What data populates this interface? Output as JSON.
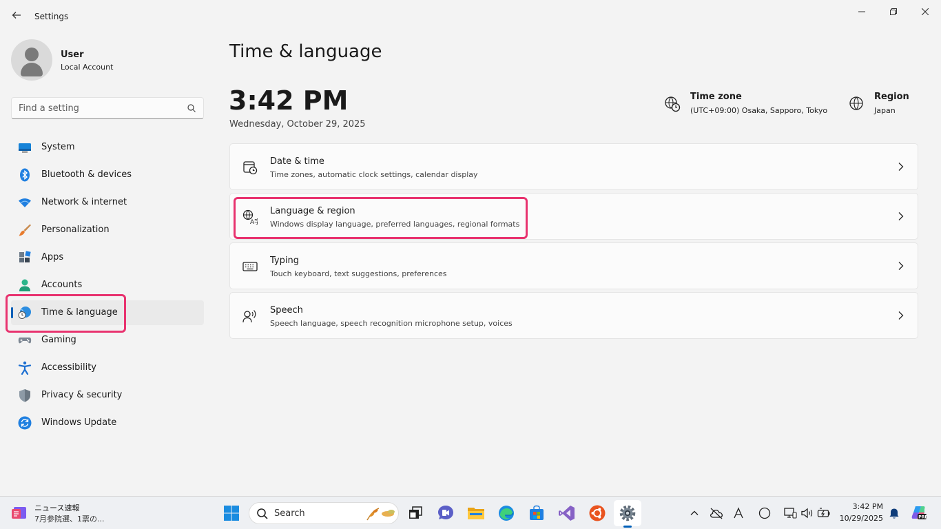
{
  "window": {
    "app_title": "Settings"
  },
  "profile": {
    "name": "User",
    "account_type": "Local Account"
  },
  "search": {
    "placeholder": "Find a setting"
  },
  "sidebar": {
    "items": [
      {
        "label": "System",
        "icon": "monitor-icon"
      },
      {
        "label": "Bluetooth & devices",
        "icon": "bluetooth-icon"
      },
      {
        "label": "Network & internet",
        "icon": "wifi-icon"
      },
      {
        "label": "Personalization",
        "icon": "paintbrush-icon"
      },
      {
        "label": "Apps",
        "icon": "apps-icon"
      },
      {
        "label": "Accounts",
        "icon": "person-icon"
      },
      {
        "label": "Time & language",
        "icon": "globe-clock-icon",
        "selected": true
      },
      {
        "label": "Gaming",
        "icon": "gamepad-icon"
      },
      {
        "label": "Accessibility",
        "icon": "accessibility-icon"
      },
      {
        "label": "Privacy & security",
        "icon": "shield-icon"
      },
      {
        "label": "Windows Update",
        "icon": "refresh-icon"
      }
    ]
  },
  "main": {
    "page_title": "Time & language",
    "clock": {
      "time": "3:42 PM",
      "date": "Wednesday, October 29, 2025"
    },
    "time_zone": {
      "label": "Time zone",
      "value": "(UTC+09:00) Osaka, Sapporo, Tokyo"
    },
    "region": {
      "label": "Region",
      "value": "Japan"
    },
    "cards": [
      {
        "title": "Date & time",
        "subtitle": "Time zones, automatic clock settings, calendar display",
        "icon": "calendar-clock-icon"
      },
      {
        "title": "Language & region",
        "subtitle": "Windows display language, preferred languages, regional formats",
        "icon": "language-icon"
      },
      {
        "title": "Typing",
        "subtitle": "Touch keyboard, text suggestions, preferences",
        "icon": "keyboard-icon"
      },
      {
        "title": "Speech",
        "subtitle": "Speech language, speech recognition microphone setup, voices",
        "icon": "speech-icon"
      }
    ]
  },
  "taskbar": {
    "news": {
      "title": "ニュース速報",
      "subtitle": "7月参院選、1票の..."
    },
    "search_label": "Search",
    "apps": [
      "windows-start-icon",
      "task-view-icon",
      "chat-icon",
      "file-explorer-icon",
      "edge-browser-icon",
      "store-icon",
      "visual-studio-icon",
      "ubuntu-icon",
      "settings-gear-icon"
    ],
    "tray": {
      "time": "3:42 PM",
      "date": "10/29/2025"
    }
  },
  "colors": {
    "accent": "#005fb8",
    "highlight": "#e8336f"
  }
}
